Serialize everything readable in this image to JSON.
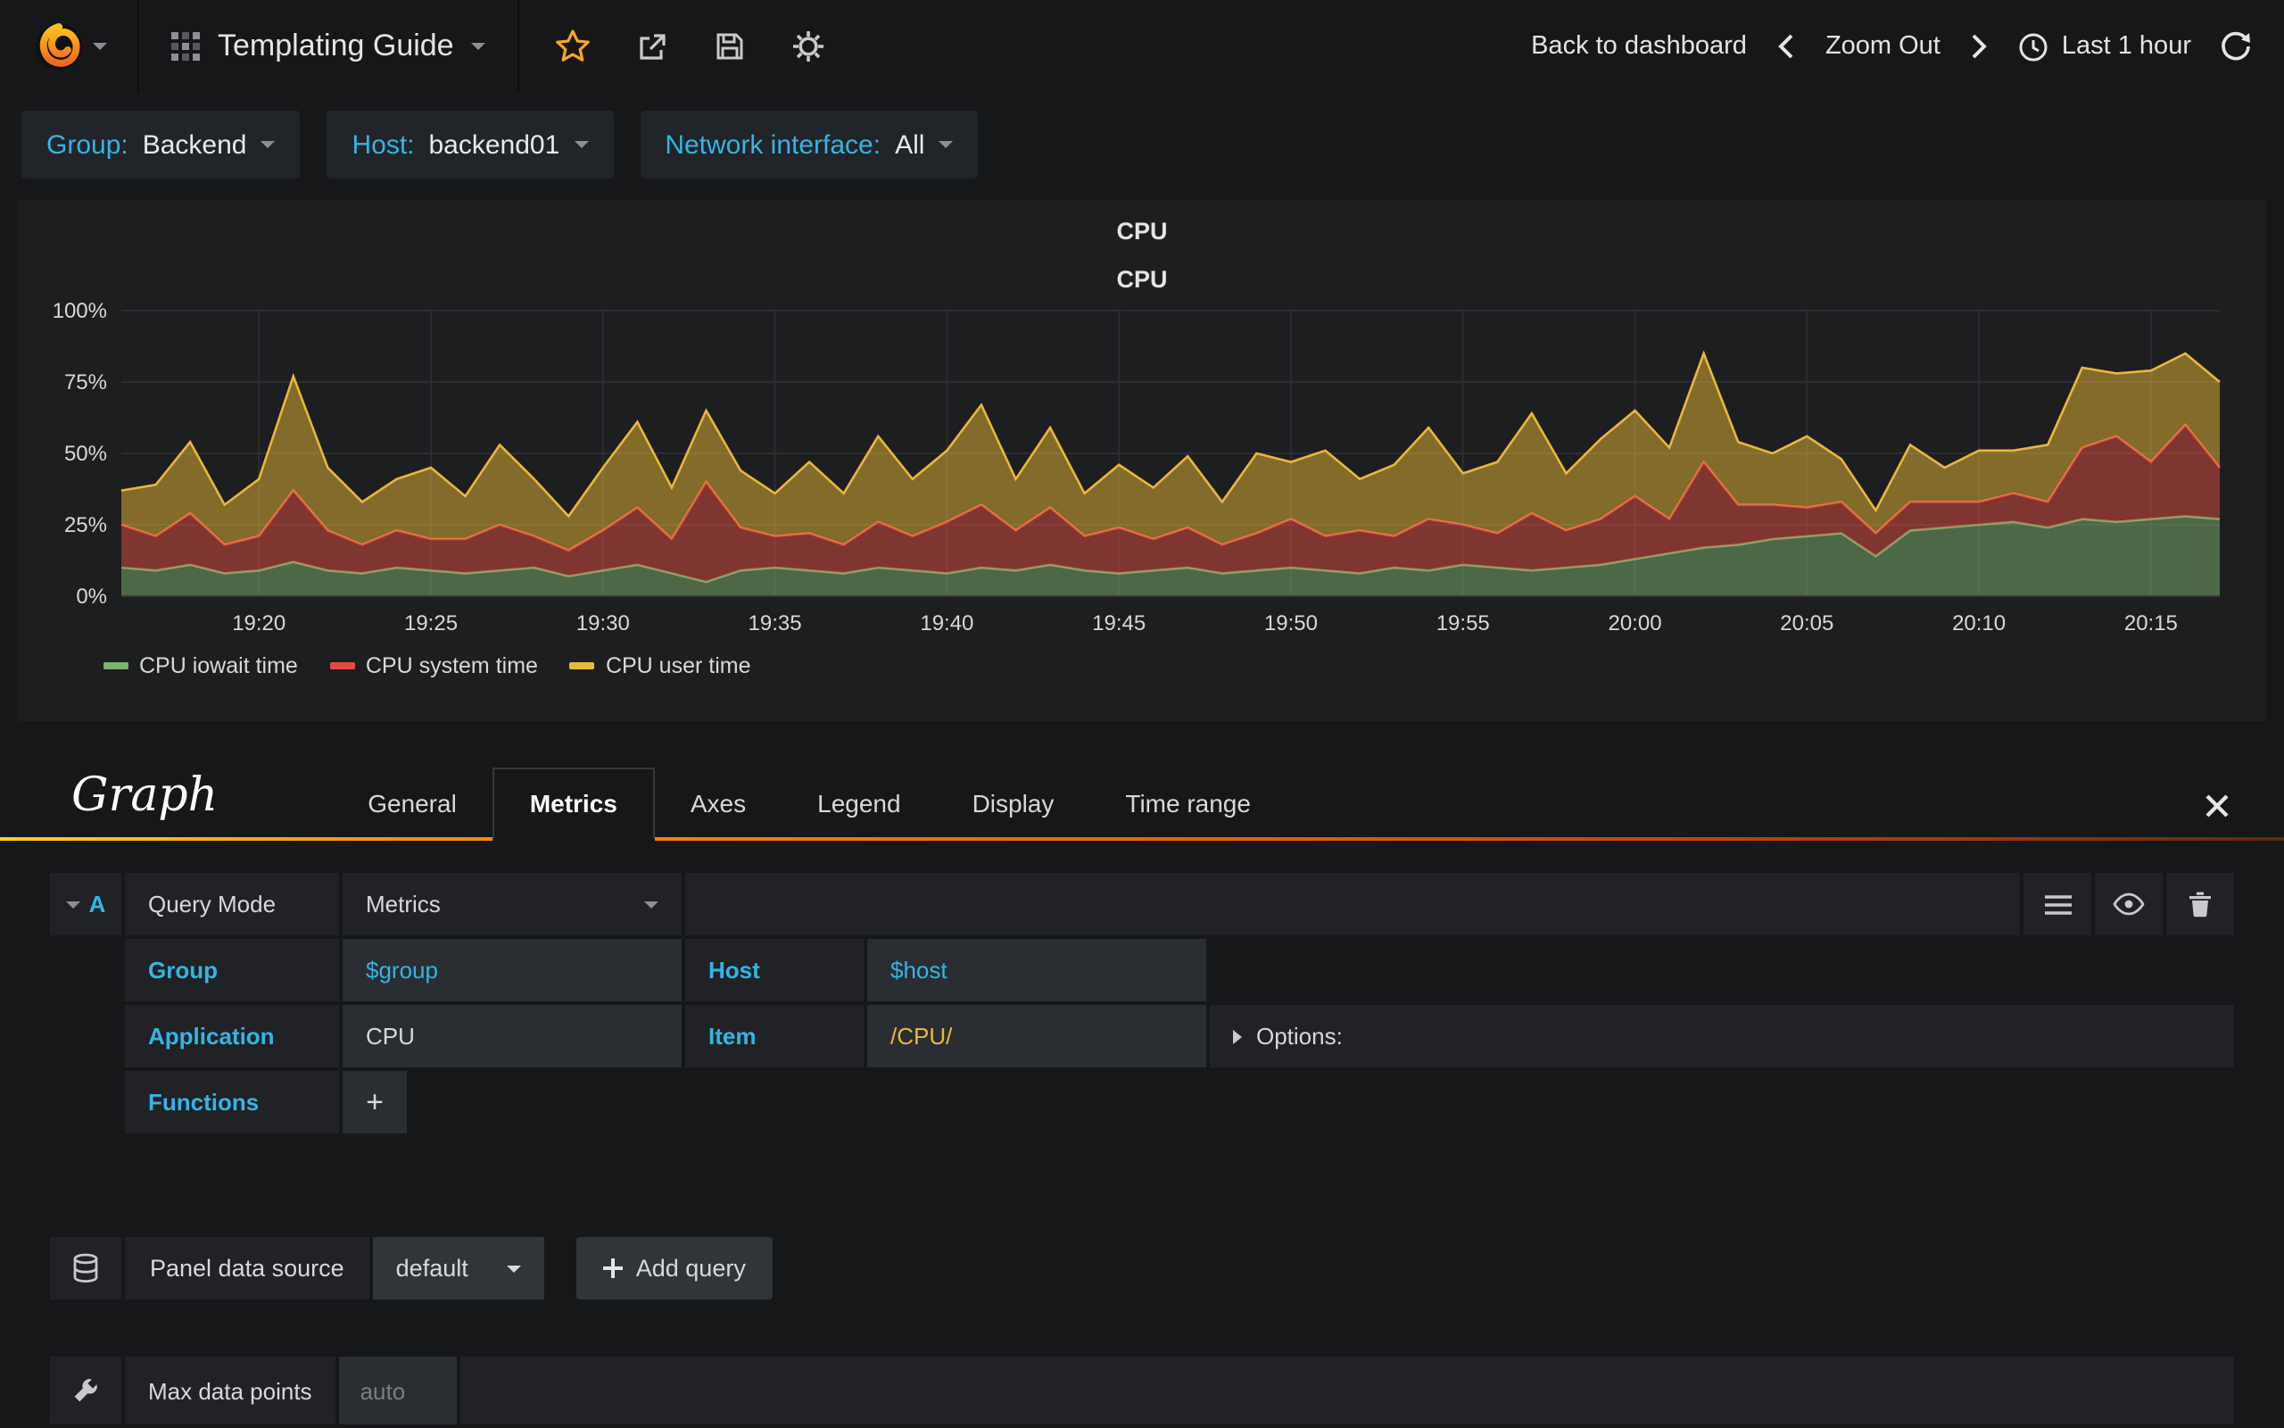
{
  "navbar": {
    "title": "Templating Guide",
    "back_to_dashboard": "Back to dashboard",
    "zoom_out": "Zoom Out",
    "time_range": "Last 1 hour"
  },
  "variables": [
    {
      "label": "Group:",
      "value": "Backend"
    },
    {
      "label": "Host:",
      "value": "backend01"
    },
    {
      "label": "Network interface:",
      "value": "All"
    }
  ],
  "panel": {
    "title": "CPU"
  },
  "chart_data": {
    "type": "area",
    "stacked": true,
    "title": "CPU",
    "grid": true,
    "legend_position": "bottom-left",
    "ylim": [
      0,
      100
    ],
    "y_ticks": [
      "0%",
      "25%",
      "50%",
      "75%",
      "100%"
    ],
    "x_ticks": [
      {
        "i": 4,
        "label": "19:20"
      },
      {
        "i": 9,
        "label": "19:25"
      },
      {
        "i": 14,
        "label": "19:30"
      },
      {
        "i": 19,
        "label": "19:35"
      },
      {
        "i": 24,
        "label": "19:40"
      },
      {
        "i": 29,
        "label": "19:45"
      },
      {
        "i": 34,
        "label": "19:50"
      },
      {
        "i": 39,
        "label": "19:55"
      },
      {
        "i": 44,
        "label": "20:00"
      },
      {
        "i": 49,
        "label": "20:05"
      },
      {
        "i": 54,
        "label": "20:10"
      },
      {
        "i": 59,
        "label": "20:15"
      }
    ],
    "series": [
      {
        "name": "CPU iowait time",
        "color": "#7EB26D",
        "values": [
          10,
          9,
          11,
          8,
          9,
          12,
          9,
          8,
          10,
          9,
          8,
          9,
          10,
          7,
          9,
          11,
          8,
          5,
          9,
          10,
          9,
          8,
          10,
          9,
          8,
          10,
          9,
          11,
          9,
          8,
          9,
          10,
          8,
          9,
          10,
          9,
          8,
          10,
          9,
          11,
          10,
          9,
          10,
          11,
          13,
          15,
          17,
          18,
          20,
          21,
          22,
          14,
          23,
          24,
          25,
          26,
          24,
          27,
          26,
          27,
          28,
          27
        ]
      },
      {
        "name": "CPU system time",
        "color": "#E24D42",
        "values": [
          15,
          12,
          18,
          10,
          12,
          25,
          14,
          10,
          13,
          11,
          12,
          16,
          11,
          9,
          14,
          20,
          12,
          35,
          15,
          11,
          13,
          10,
          16,
          12,
          18,
          22,
          14,
          20,
          12,
          16,
          11,
          14,
          10,
          13,
          17,
          12,
          15,
          11,
          18,
          14,
          12,
          20,
          13,
          16,
          22,
          12,
          30,
          14,
          12,
          10,
          11,
          8,
          10,
          9,
          8,
          10,
          9,
          25,
          30,
          20,
          32,
          18
        ]
      },
      {
        "name": "CPU user time",
        "color": "#EAB839",
        "values": [
          12,
          18,
          25,
          14,
          20,
          40,
          22,
          15,
          18,
          25,
          15,
          28,
          20,
          12,
          22,
          30,
          18,
          25,
          20,
          15,
          25,
          18,
          30,
          20,
          25,
          35,
          18,
          28,
          15,
          22,
          18,
          25,
          15,
          28,
          20,
          30,
          18,
          25,
          32,
          18,
          25,
          35,
          20,
          28,
          30,
          25,
          38,
          22,
          18,
          25,
          15,
          8,
          20,
          12,
          18,
          15,
          20,
          28,
          22,
          32,
          25,
          30
        ]
      }
    ]
  },
  "editor": {
    "panel_type": "Graph",
    "tabs": [
      "General",
      "Metrics",
      "Axes",
      "Legend",
      "Display",
      "Time range"
    ],
    "active_tab": "Metrics",
    "query": {
      "ref": "A",
      "query_mode_label": "Query Mode",
      "query_mode_value": "Metrics",
      "group_label": "Group",
      "group_value": "$group",
      "host_label": "Host",
      "host_value": "$host",
      "application_label": "Application",
      "application_value": "CPU",
      "item_label": "Item",
      "item_value": "/CPU/",
      "options_label": "Options:",
      "functions_label": "Functions",
      "add_function": "+"
    },
    "datasource": {
      "label": "Panel data source",
      "value": "default",
      "add_query": "Add query"
    },
    "max_data_points": {
      "label": "Max data points",
      "placeholder": "auto"
    }
  }
}
